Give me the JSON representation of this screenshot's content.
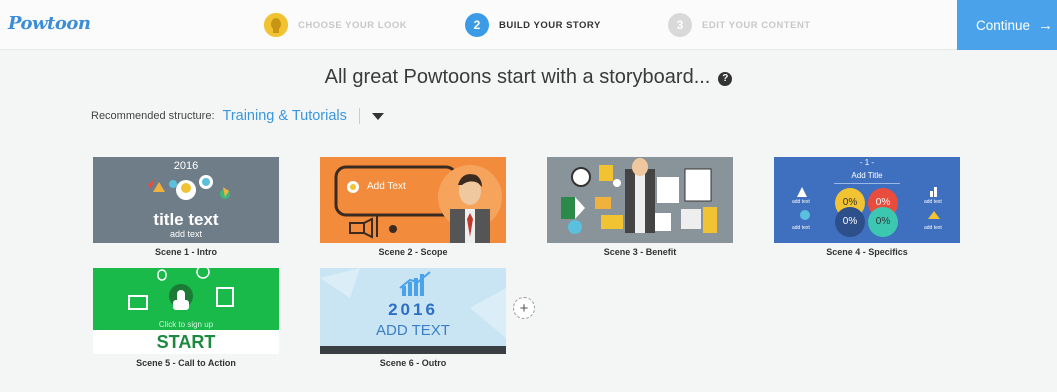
{
  "app": {
    "logo": "Powtoon"
  },
  "steps": [
    {
      "number": "",
      "label": "CHOOSE YOUR LOOK"
    },
    {
      "number": "2",
      "label": "BUILD YOUR STORY"
    },
    {
      "number": "3",
      "label": "EDIT YOUR CONTENT"
    }
  ],
  "continue_label": "Continue",
  "continue_arrow": "→",
  "headline": "All great Powtoons start with a storyboard...",
  "help_glyph": "?",
  "structure": {
    "label": "Recommended structure:",
    "value": "Training & Tutorials"
  },
  "scenes": [
    {
      "caption": "Scene 1 - Intro",
      "year": "2016",
      "title": "title text",
      "subtitle": "add text"
    },
    {
      "caption": "Scene 2 - Scope",
      "text": "Add Text"
    },
    {
      "caption": "Scene 3 - Benefit"
    },
    {
      "caption": "Scene 4 - Specifics",
      "number": "- 1 -",
      "title": "Add Title",
      "percent": "0%",
      "small": "add text"
    },
    {
      "caption": "Scene 5 - Call to Action",
      "hint": "Click to sign up",
      "title": "START"
    },
    {
      "caption": "Scene 6 - Outro",
      "year": "2016",
      "text": "ADD TEXT"
    }
  ],
  "add_scene_glyph": "+",
  "colors": {
    "accent": "#4aa3ea",
    "link": "#3a97de",
    "step_active": "#3c9be6",
    "step_dim": "#d9d9d9",
    "step_one": "#f1c232"
  }
}
